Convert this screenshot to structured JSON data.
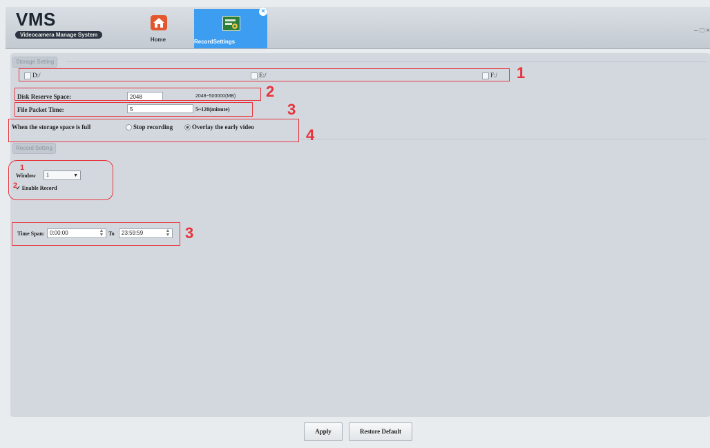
{
  "app": {
    "title": "VMS",
    "subtitle": "Videocamera Manage System",
    "window_controls": "– □ ×"
  },
  "nav": {
    "home_label": "Home",
    "record_label": "RecordSettings",
    "close_glyph": "×"
  },
  "storage": {
    "section_title": "Storage Setting",
    "drives": [
      {
        "label": "D:/",
        "checked": false
      },
      {
        "label": "E:/",
        "checked": false
      },
      {
        "label": "F:/",
        "checked": false
      }
    ],
    "disk_reserve_label": "Disk Reserve Space:",
    "disk_reserve_value": "2048",
    "disk_reserve_hint": "2048~500000(MB)",
    "packet_time_label": "File Packet Time:",
    "packet_time_value": "5",
    "packet_time_hint": "5~120(minute)",
    "full_label": "When the storage space is full",
    "option_stop": "Stop recording",
    "option_overlay": "Overlay the early video",
    "selected_option": "overlay"
  },
  "record": {
    "section_title": "Record Setting",
    "window_label": "Window",
    "window_value": "1",
    "enable_label": "Enable Record",
    "enable_checked": true,
    "timespan_label": "Time Span:",
    "time_from": "0:00:00",
    "to_label": "To",
    "time_to": "23:59:59"
  },
  "annotations": {
    "n1": "1",
    "n2": "2",
    "n3": "3",
    "n4": "4",
    "s1": "1",
    "s2": "2",
    "s3": "3"
  },
  "footer": {
    "apply_label": "Apply",
    "restore_label": "Restore Default"
  },
  "colors": {
    "accent": "#3d9df0",
    "annotation": "#e8323a",
    "panel": "#d3d8df"
  }
}
